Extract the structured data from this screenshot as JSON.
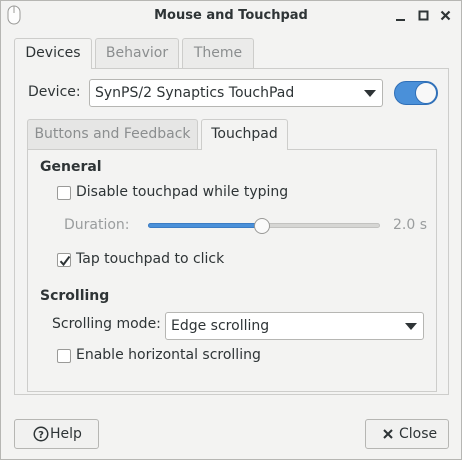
{
  "window": {
    "title": "Mouse and Touchpad"
  },
  "tabs": [
    {
      "label": "Devices",
      "active": true
    },
    {
      "label": "Behavior",
      "active": false
    },
    {
      "label": "Theme",
      "active": false
    }
  ],
  "device": {
    "label": "Device:",
    "selected": "SynPS/2 Synaptics TouchPad",
    "enabled": true
  },
  "subtabs": [
    {
      "label": "Buttons and Feedback",
      "active": false
    },
    {
      "label": "Touchpad",
      "active": true
    }
  ],
  "general": {
    "heading": "General",
    "disable_while_typing": {
      "label": "Disable touchpad while typing",
      "checked": false
    },
    "duration": {
      "label": "Duration:",
      "value_text": "2.0 s",
      "fraction": 0.49,
      "enabled": false
    },
    "tap_to_click": {
      "label": "Tap touchpad to click",
      "checked": true
    }
  },
  "scrolling": {
    "heading": "Scrolling",
    "mode_label": "Scrolling mode:",
    "mode_selected": "Edge scrolling",
    "horizontal": {
      "label": "Enable horizontal scrolling",
      "checked": false
    }
  },
  "footer": {
    "help_label": "Help",
    "close_label": "Close"
  },
  "colors": {
    "accent": "#4a90d9",
    "window_bg": "#f3f3f2",
    "text": "#2e3436"
  }
}
